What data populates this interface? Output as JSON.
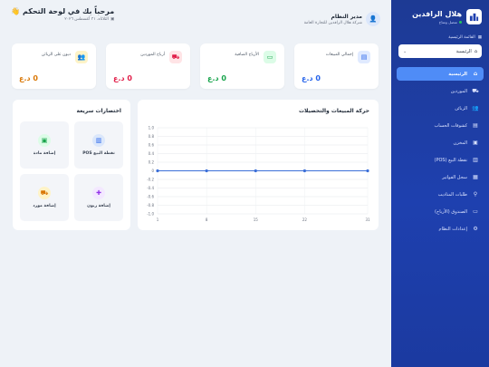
{
  "brand": {
    "title": "هلال الرافدين",
    "status": "متصل ومتاح"
  },
  "sidebar": {
    "menu_label": "القائمة الرئيسية",
    "select_value": "الرئيسية",
    "items": [
      {
        "label": "الرئيسية",
        "icon": "home-icon",
        "active": true
      },
      {
        "label": "الموردين",
        "icon": "truck-icon",
        "active": false
      },
      {
        "label": "الزبائن",
        "icon": "users-icon",
        "active": false
      },
      {
        "label": "كشوفات الحساب",
        "icon": "file-icon",
        "active": false
      },
      {
        "label": "المخزن",
        "icon": "box-icon",
        "active": false
      },
      {
        "label": "نقطة البيع (POS)",
        "icon": "register-icon",
        "active": false
      },
      {
        "label": "سجل الفواتير",
        "icon": "invoice-icon",
        "active": false
      },
      {
        "label": "طلبات المناديب",
        "icon": "motorcycle-icon",
        "active": false
      },
      {
        "label": "الصندوق (الأرباح)",
        "icon": "cash-icon",
        "active": false
      },
      {
        "label": "إعدادات النظام",
        "icon": "gear-icon",
        "active": false
      }
    ]
  },
  "header": {
    "user_name": "مدير النظام",
    "company": "شركة هلال الرافدين للتجارة العامة",
    "greeting": "مرحباً بك في لوحة التحكم",
    "greeting_emoji": "👋",
    "date": "الثلاثاء، ٣١ أغسطس ٢٠٢٦"
  },
  "stats": [
    {
      "label": "إجمالي المبيعات",
      "value": "0 د.ع",
      "icon": "document-icon",
      "color": "#2563eb",
      "bg": "#e0eaff"
    },
    {
      "label": "الأرباح الصافية",
      "value": "0 د.ع",
      "icon": "money-icon",
      "color": "#16a34a",
      "bg": "#dcfce7"
    },
    {
      "label": "أرباح الموردين",
      "value": "0 د.ع",
      "icon": "truck-icon",
      "color": "#e11d48",
      "bg": "#ffe4e6"
    },
    {
      "label": "ديون على الزبائن",
      "value": "0 د.ع",
      "icon": "users-icon",
      "color": "#d97706",
      "bg": "#fef3c7"
    }
  ],
  "chart_card": {
    "title": "حركة المبيعات والتحصيلات"
  },
  "chart_data": {
    "type": "line",
    "x": [
      1,
      8,
      15,
      22,
      31
    ],
    "series": [
      {
        "values": [
          0,
          0,
          0,
          0,
          0
        ]
      }
    ],
    "ylim": [
      -1,
      1
    ],
    "yticks": [
      "1.0",
      "0.8",
      "0.6",
      "0.4",
      "0.2",
      "0",
      "-0.2",
      "-0.4",
      "-0.6",
      "-0.8",
      "-1.0"
    ],
    "grid": true,
    "line_color": "#3b6fd8"
  },
  "shortcuts": {
    "title": "اختصارات سريعة",
    "items": [
      {
        "label": "نقطة البيع POS",
        "icon": "register-icon",
        "color": "#2563eb",
        "bg": "#dbe7fb"
      },
      {
        "label": "إضافة مادة",
        "icon": "box-icon",
        "color": "#16a34a",
        "bg": "#dcfce7"
      },
      {
        "label": "إضافة زبون",
        "icon": "user-plus-icon",
        "color": "#9333ea",
        "bg": "#f3e8ff"
      },
      {
        "label": "إضافة مورد",
        "icon": "truck-icon",
        "color": "#d97706",
        "bg": "#fef3c7"
      }
    ]
  }
}
